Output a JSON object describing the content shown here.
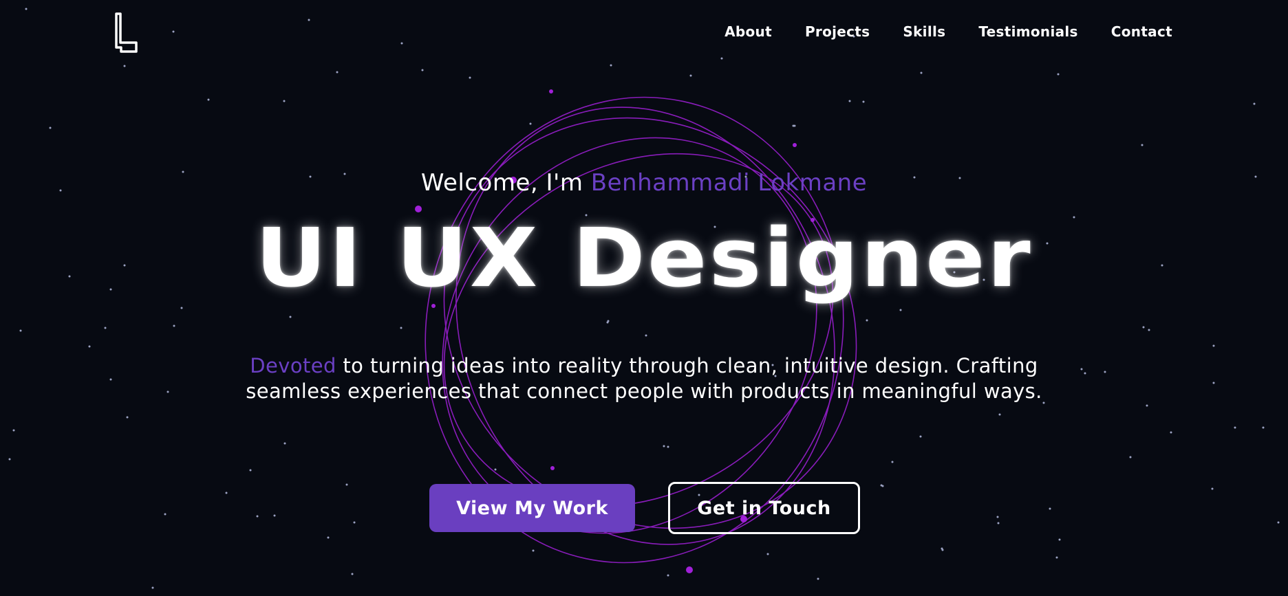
{
  "brand": {
    "logo_icon": "letter-l-logo-icon"
  },
  "nav": {
    "items": [
      {
        "label": "About"
      },
      {
        "label": "Projects"
      },
      {
        "label": "Skills"
      },
      {
        "label": "Testimonials"
      },
      {
        "label": "Contact"
      }
    ]
  },
  "hero": {
    "welcome_prefix": "Welcome, I'm ",
    "name": "Benhammadi Lokmane",
    "title": "UI UX Designer",
    "desc_accent": "Devoted",
    "desc_rest": " to turning ideas into reality through clean, intuitive design. Crafting seamless experiences that connect people with products in meaningful ways.",
    "primary_button": "View My Work",
    "secondary_button": "Get in Touch"
  },
  "colors": {
    "background": "#070a12",
    "accent": "#6b40c4",
    "primary_button": "#6a3fc0",
    "orb_lines": "#a020d8",
    "text": "#ffffff"
  }
}
